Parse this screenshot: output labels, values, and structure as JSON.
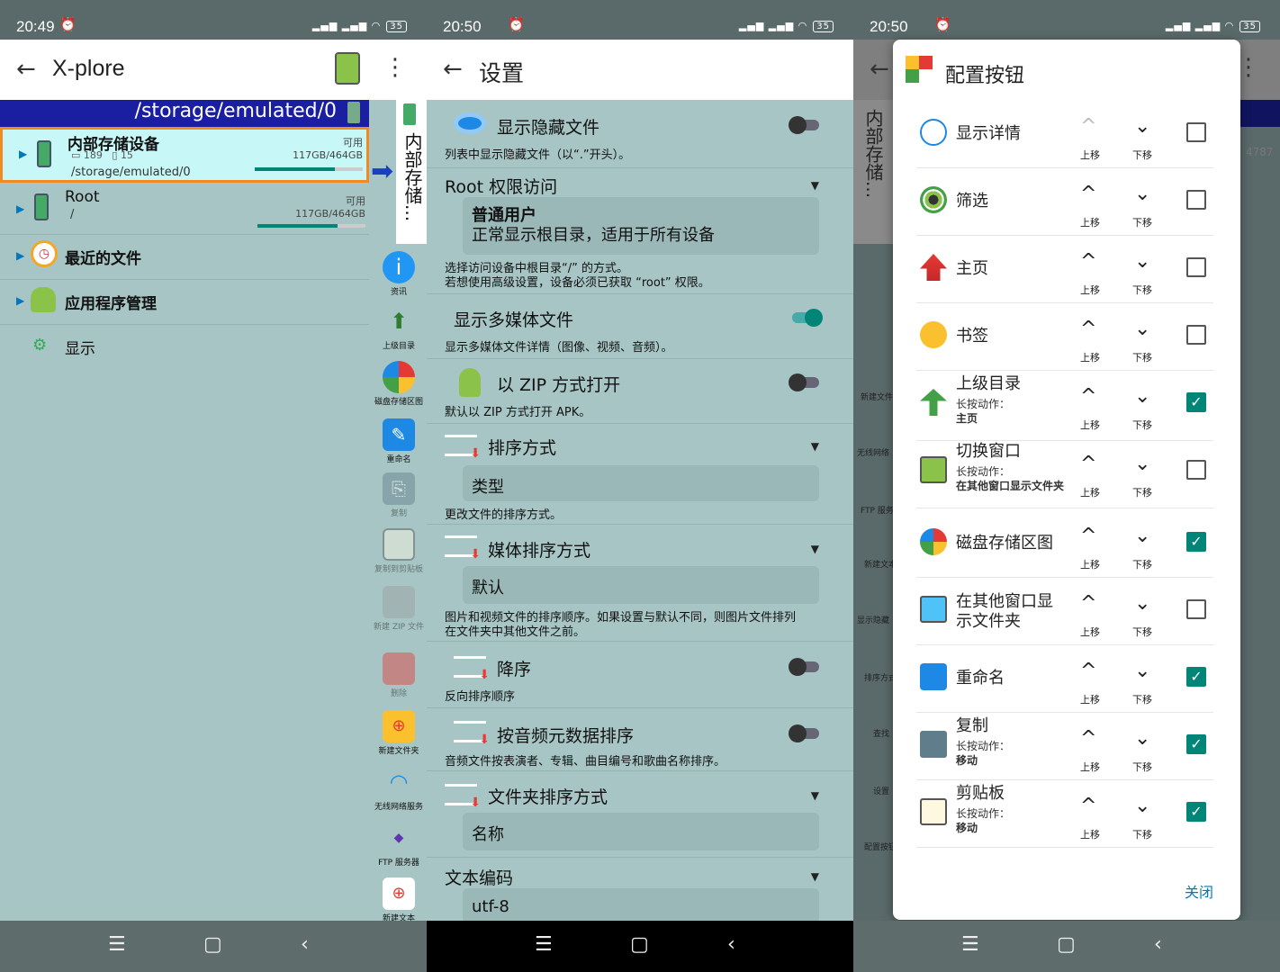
{
  "status": {
    "s1_time": "20:49",
    "s2_time": "20:50",
    "s3_time": "20:50",
    "battery": "35"
  },
  "s1": {
    "title": "X-plore",
    "path": "/storage/emulated/0",
    "items": [
      {
        "label": "内部存储设备",
        "folders": "189",
        "files": "15",
        "sub": "/storage/emulated/0",
        "avail": "可用",
        "size": "117GB/464GB"
      },
      {
        "label": "Root",
        "sub": "/",
        "avail": "可用",
        "size": "117GB/464GB"
      },
      {
        "label": "最近的文件"
      },
      {
        "label": "应用程序管理"
      },
      {
        "label": "显示"
      }
    ],
    "side_tab": "内部存储...",
    "sidebar": [
      "资讯",
      "上级目录",
      "磁盘存储区图",
      "重命名",
      "复制",
      "复制到剪贴板",
      "新建 ZIP 文件",
      "删除",
      "新建文件夹",
      "无线网络服务",
      "FTP 服务器",
      "新建文本"
    ]
  },
  "s2": {
    "title": "设置",
    "settings": {
      "hidden_title": "显示隐藏文件",
      "hidden_desc": "列表中显示隐藏文件（以“.”开头）。",
      "root_title": "Root 权限访问",
      "root_val1": "普通用户",
      "root_val2": "正常显示根目录，适用于所有设备",
      "root_desc1": "选择访问设备中根目录“/” 的方式。",
      "root_desc2": "若想使用高级设置，设备必须已获取 “root” 权限。",
      "media_title": "显示多媒体文件",
      "media_desc": "显示多媒体文件详情（图像、视频、音频）。",
      "zip_title": "以 ZIP 方式打开",
      "zip_desc": "默认以 ZIP 方式打开 APK。",
      "sort_title": "排序方式",
      "sort_val": "类型",
      "sort_desc": "更改文件的排序方式。",
      "msort_title": "媒体排序方式",
      "msort_val": "默认",
      "msort_desc1": "图片和视频文件的排序顺序。如果设置与默认不同，则图片文件排列",
      "msort_desc2": "在文件夹中其他文件之前。",
      "desc_title": "降序",
      "desc_desc": "反向排序顺序",
      "audio_title": "按音频元数据排序",
      "audio_desc": "音频文件按表演者、专辑、曲目编号和歌曲名称排序。",
      "fsort_title": "文件夹排序方式",
      "fsort_val": "名称",
      "enc_title": "文本编码",
      "enc_val": "utf-8"
    }
  },
  "s3": {
    "bg_tab": "内部存储...",
    "bg_sidebar": [
      "新建文件",
      "无线网络",
      "FTP 服务",
      "新建文本",
      "显示隐藏",
      "排序方式",
      "查找",
      "设置",
      "配置按钮"
    ],
    "bg_partial": "4787",
    "dialog_title": "配置按钮",
    "up": "上移",
    "down": "下移",
    "rows": [
      {
        "label": "显示详情",
        "checked": false
      },
      {
        "label": "筛选",
        "checked": false
      },
      {
        "label": "主页",
        "checked": false
      },
      {
        "label": "书签",
        "checked": false
      },
      {
        "label": "上级目录",
        "sub1": "长按动作：",
        "sub2": "主页",
        "checked": true
      },
      {
        "label": "切换窗口",
        "sub1": "长按动作：",
        "sub2": "在其他窗口显示文件夹",
        "checked": false
      },
      {
        "label": "磁盘存储区图",
        "checked": true
      },
      {
        "label": "在其他窗口显示文件夹",
        "checked": false
      },
      {
        "label": "重命名",
        "checked": true
      },
      {
        "label": "复制",
        "sub1": "长按动作：",
        "sub2": "移动",
        "checked": true
      },
      {
        "label": "剪贴板",
        "sub1": "长按动作：",
        "sub2": "移动",
        "checked": true
      }
    ],
    "close": "关闭"
  }
}
